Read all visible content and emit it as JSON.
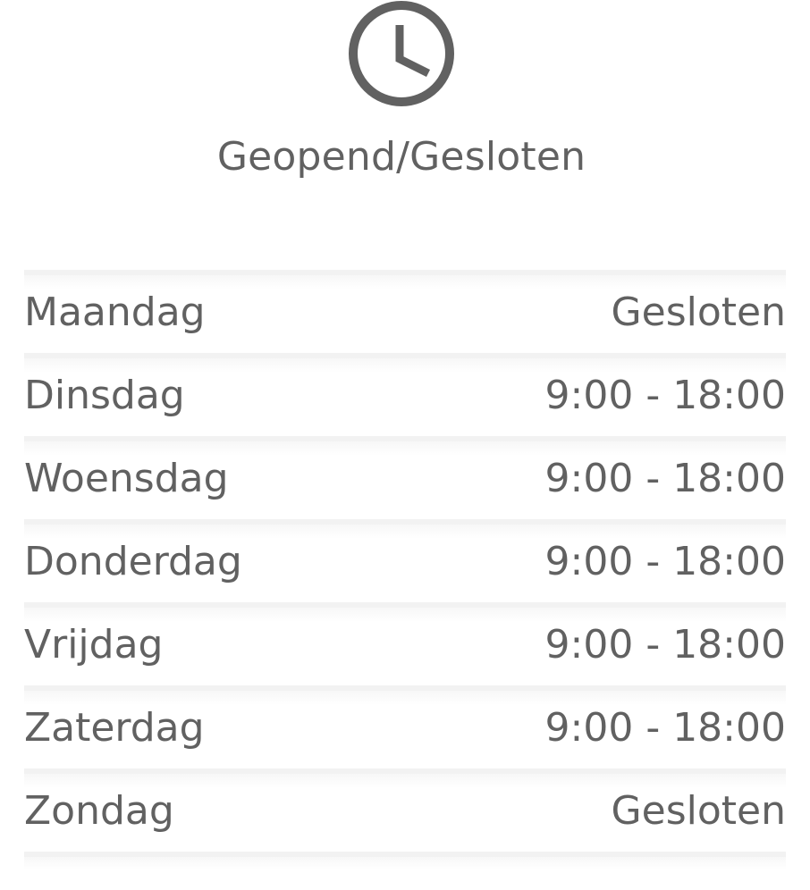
{
  "header": {
    "icon": "clock-icon",
    "title": "Geopend/Gesloten"
  },
  "hours": [
    {
      "day": "Maandag",
      "hours": "Gesloten"
    },
    {
      "day": "Dinsdag",
      "hours": "9:00 - 18:00"
    },
    {
      "day": "Woensdag",
      "hours": "9:00 - 18:00"
    },
    {
      "day": "Donderdag",
      "hours": "9:00 - 18:00"
    },
    {
      "day": "Vrijdag",
      "hours": "9:00 - 18:00"
    },
    {
      "day": "Zaterdag",
      "hours": "9:00 - 18:00"
    },
    {
      "day": "Zondag",
      "hours": "Gesloten"
    }
  ],
  "colors": {
    "text": "#616161",
    "divider": "#f2f2f2",
    "background": "#ffffff"
  }
}
